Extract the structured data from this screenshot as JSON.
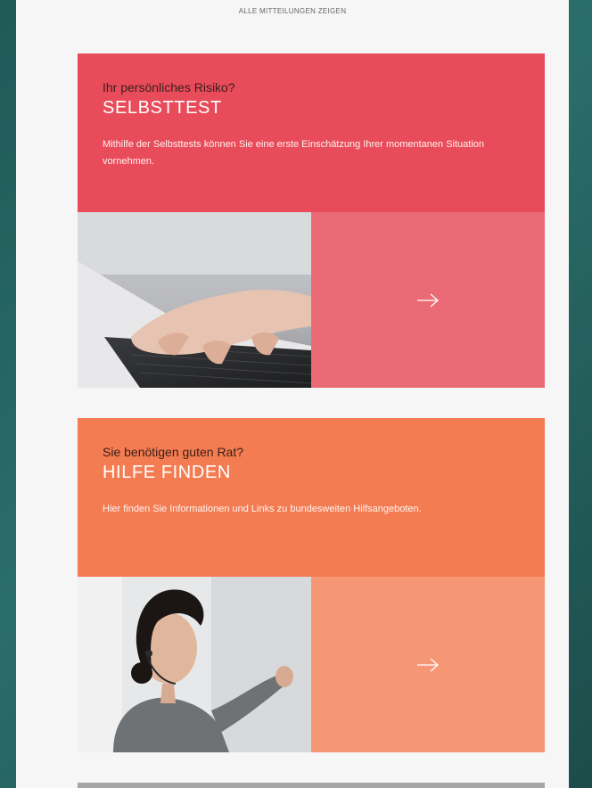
{
  "top_link": "ALLE MITTEILUNGEN ZEIGEN",
  "cards": [
    {
      "eyebrow": "Ihr persönliches Risiko?",
      "title": "SELBSTTEST",
      "description": "Mithilfe der Selbsttests können Sie eine erste Einschätzung Ihrer momentanen Situation vornehmen.",
      "color": "#e84b59",
      "image_icon": "keyboard-typing-photo",
      "action_icon": "arrow-right-icon"
    },
    {
      "eyebrow": "Sie benötigen guten Rat?",
      "title": "HILFE FINDEN",
      "description": "Hier finden Sie Informationen und Links zu bundesweiten Hilfsangeboten.",
      "color": "#f47c52",
      "image_icon": "woman-headset-photo",
      "action_icon": "arrow-right-icon"
    }
  ]
}
